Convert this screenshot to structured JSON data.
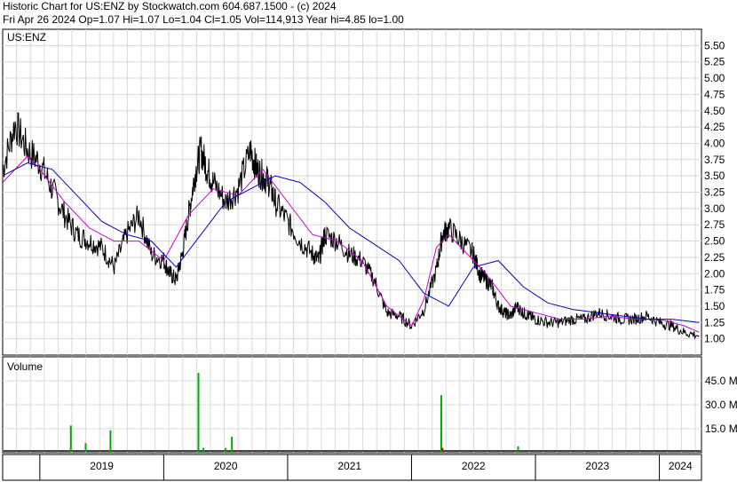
{
  "header": {
    "line1": "Historic Chart for US:ENZ by Stockwatch.com 604.687.1500 - (c) 2024",
    "line2": "Fri Apr 26 2024  Op=1.07  Hi=1.07  Lo=1.04  Cl=1.05  Vol=114,913  Year hi=4.85  lo=1.00"
  },
  "chart_data": [
    {
      "type": "line",
      "symbol_label": "US:ENZ",
      "ylim": [
        0.75,
        5.75
      ],
      "y_ticks": [
        "5.50",
        "5.25",
        "5.00",
        "4.75",
        "4.50",
        "4.25",
        "4.00",
        "3.75",
        "3.50",
        "3.25",
        "3.00",
        "2.75",
        "2.50",
        "2.25",
        "2.00",
        "1.75",
        "1.50",
        "1.25",
        "1.00"
      ],
      "x_labels": [
        "2019",
        "2020",
        "2021",
        "2022",
        "2023",
        "2024"
      ],
      "xlim": [
        2018.7,
        2024.34
      ],
      "grid": true,
      "series": [
        {
          "style": "price",
          "color": "#000000",
          "x": [
            2018.7,
            2018.8,
            2018.9,
            2019.0,
            2019.1,
            2019.2,
            2019.3,
            2019.4,
            2019.5,
            2019.6,
            2019.7,
            2019.8,
            2019.9,
            2020.0,
            2020.05,
            2020.1,
            2020.15,
            2020.2,
            2020.25,
            2020.3,
            2020.35,
            2020.4,
            2020.5,
            2020.6,
            2020.7,
            2020.75,
            2020.8,
            2020.85,
            2020.9,
            2021.0,
            2021.1,
            2021.2,
            2021.25,
            2021.3,
            2021.4,
            2021.5,
            2021.6,
            2021.7,
            2021.8,
            2021.9,
            2022.0,
            2022.1,
            2022.2,
            2022.25,
            2022.3,
            2022.4,
            2022.5,
            2022.55,
            2022.6,
            2022.65,
            2022.7,
            2022.75,
            2022.8,
            2022.85,
            2022.9,
            2022.95,
            2023.0,
            2023.1,
            2023.2,
            2023.3,
            2023.4,
            2023.5,
            2023.6,
            2023.7,
            2023.8,
            2023.9,
            2024.0,
            2024.1,
            2024.2,
            2024.32
          ],
          "values": [
            3.6,
            4.3,
            3.9,
            3.7,
            3.3,
            2.9,
            2.6,
            2.5,
            2.4,
            2.1,
            2.6,
            2.9,
            2.3,
            2.2,
            2.0,
            1.9,
            2.3,
            2.9,
            3.5,
            3.9,
            3.6,
            3.4,
            3.1,
            3.3,
            3.9,
            3.6,
            3.5,
            3.4,
            3.1,
            2.8,
            2.5,
            2.3,
            2.2,
            2.6,
            2.5,
            2.3,
            2.2,
            1.9,
            1.4,
            1.35,
            1.2,
            1.45,
            2.05,
            2.6,
            2.7,
            2.5,
            2.3,
            2.0,
            1.9,
            1.8,
            1.5,
            1.4,
            1.35,
            1.5,
            1.4,
            1.35,
            1.3,
            1.25,
            1.25,
            1.3,
            1.3,
            1.4,
            1.35,
            1.3,
            1.3,
            1.35,
            1.25,
            1.2,
            1.1,
            1.05
          ]
        },
        {
          "style": "ma-short",
          "color": "#cc00cc",
          "x": [
            2018.7,
            2018.9,
            2019.0,
            2019.2,
            2019.4,
            2019.6,
            2019.8,
            2020.0,
            2020.2,
            2020.4,
            2020.6,
            2020.8,
            2021.0,
            2021.2,
            2021.4,
            2021.6,
            2021.8,
            2022.0,
            2022.1,
            2022.2,
            2022.3,
            2022.4,
            2022.6,
            2022.8,
            2023.0,
            2023.2,
            2023.4,
            2023.6,
            2023.8,
            2024.0,
            2024.2,
            2024.32
          ],
          "values": [
            3.4,
            3.8,
            3.6,
            3.1,
            2.7,
            2.5,
            2.5,
            2.2,
            2.9,
            3.3,
            3.2,
            3.6,
            3.1,
            2.6,
            2.5,
            2.2,
            1.5,
            1.2,
            1.6,
            2.4,
            2.6,
            2.4,
            2.0,
            1.5,
            1.4,
            1.3,
            1.3,
            1.35,
            1.3,
            1.3,
            1.2,
            1.1
          ]
        },
        {
          "style": "ma-long",
          "color": "#0000cc",
          "x": [
            2018.7,
            2018.9,
            2019.1,
            2019.3,
            2019.5,
            2019.7,
            2019.9,
            2020.1,
            2020.3,
            2020.5,
            2020.7,
            2020.9,
            2021.1,
            2021.3,
            2021.5,
            2021.7,
            2021.9,
            2022.1,
            2022.3,
            2022.5,
            2022.7,
            2022.9,
            2023.1,
            2023.3,
            2023.5,
            2023.7,
            2023.9,
            2024.1,
            2024.32
          ],
          "values": [
            3.5,
            3.7,
            3.6,
            3.2,
            2.8,
            2.6,
            2.5,
            2.1,
            2.6,
            3.1,
            3.3,
            3.5,
            3.4,
            3.1,
            2.7,
            2.45,
            2.2,
            1.7,
            1.5,
            2.1,
            2.2,
            1.8,
            1.55,
            1.45,
            1.4,
            1.35,
            1.3,
            1.3,
            1.25
          ]
        }
      ]
    },
    {
      "type": "bar",
      "title": "Volume",
      "ylim": [
        0,
        60
      ],
      "y_ticks": [
        "45.0 M",
        "30.0 M",
        "15.0 M"
      ],
      "x": [
        2019.25,
        2019.37,
        2019.57,
        2020.28,
        2020.32,
        2020.5,
        2020.55,
        2022.24,
        2022.25,
        2022.86
      ],
      "values": [
        17,
        6,
        14,
        50,
        3,
        3,
        10,
        36,
        3,
        4
      ],
      "colors": [
        "#00aa00",
        "#00aa00",
        "#00aa00",
        "#00aa00",
        "#00aa00",
        "#00aa00",
        "#00aa00",
        "#00aa00",
        "#cc0000",
        "#00aa00"
      ]
    }
  ]
}
